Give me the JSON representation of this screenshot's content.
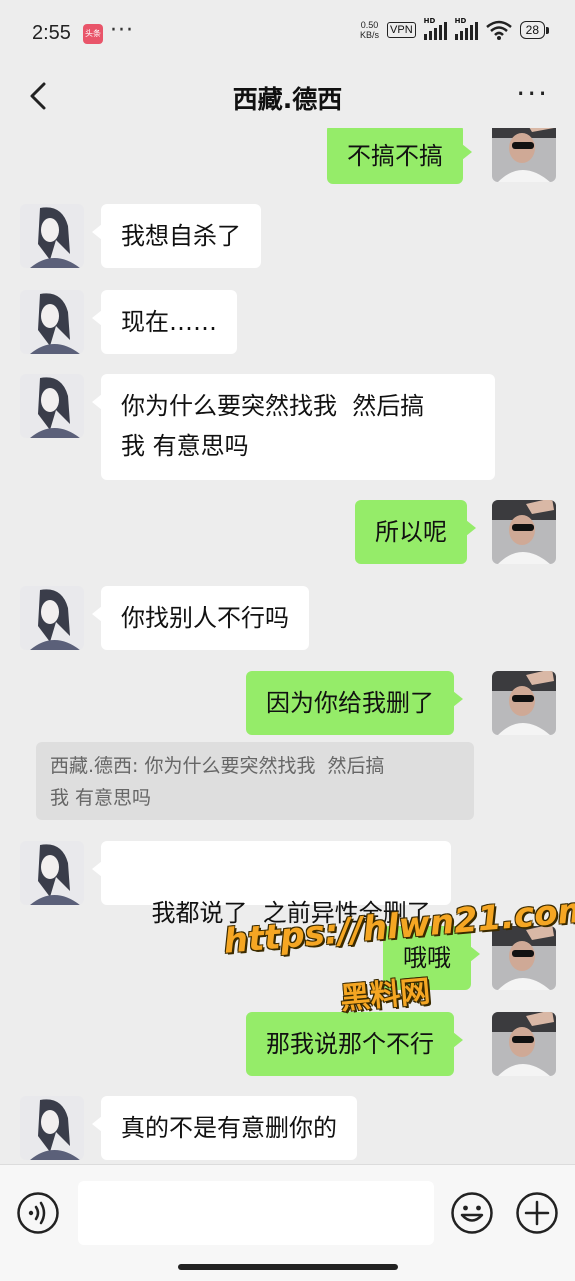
{
  "status_bar": {
    "time": "2:55",
    "app_badge": "头条",
    "more_dots": "···",
    "net_speed_value": "0.50",
    "net_speed_unit": "KB/s",
    "vpn": "VPN",
    "sig_label_1": "HD",
    "sig_label_2": "HD",
    "battery": "28"
  },
  "header": {
    "title": "西藏.德西",
    "back_icon": "chevron-left-icon",
    "more_icon": "more-dots-icon",
    "more_glyph": "···"
  },
  "messages": [
    {
      "side": "out",
      "text": "不搞不搞"
    },
    {
      "side": "in",
      "text": "我想自杀了"
    },
    {
      "side": "in",
      "text": "现在……"
    },
    {
      "side": "in",
      "text_line1": "你为什么要突然找我  然后搞",
      "text_line2": "我 有意思吗"
    },
    {
      "side": "out",
      "text": "所以呢"
    },
    {
      "side": "in",
      "text": "你找别人不行吗"
    },
    {
      "side": "out",
      "text": "因为你给我删了"
    },
    {
      "side": "in",
      "text": "我都说了  之前异性全删了"
    },
    {
      "side": "out",
      "text": "哦哦"
    },
    {
      "side": "out",
      "text": "那我说那个不行"
    },
    {
      "side": "in",
      "text": "真的不是有意删你的"
    }
  ],
  "quote": {
    "line1": "西藏.德西: 你为什么要突然找我  然后搞",
    "line2": "我 有意思吗"
  },
  "watermark": {
    "url": "https://hlwn21.com",
    "name": "黑料网"
  },
  "input_bar": {
    "voice_icon": "voice-icon",
    "emoji_icon": "emoji-icon",
    "plus_icon": "plus-icon",
    "value": ""
  },
  "colors": {
    "background": "#ededed",
    "outgoing_bubble": "#95ec69",
    "incoming_bubble": "#ffffff"
  }
}
